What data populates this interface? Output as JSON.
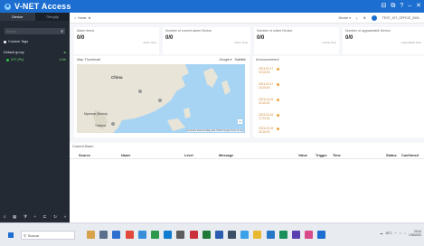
{
  "app": {
    "title": "V-NET Access",
    "window_controls": [
      "⊟",
      "⧉",
      "?",
      "–",
      "✕"
    ]
  },
  "sidebar": {
    "tabs": [
      "Device",
      "Thingify"
    ],
    "search_placeholder": "Search",
    "all_label": "Custom Tags",
    "group_label": "Default group",
    "group_count": "",
    "device_label": "IOT (Ps)",
    "device_count": "1/4h"
  },
  "topbar": {
    "breadcrumb_home": "Home",
    "breadcrumb_sep": "⊕",
    "device_menu": "Device ▾",
    "user": "TEST_IOT_OFFICE_0001"
  },
  "stats": [
    {
      "label": "Alarm Items",
      "value": "0/0",
      "link": "Alarm Now"
    },
    {
      "label": "Number of current alarm Device",
      "value": "0/0",
      "link": "Alarm Now"
    },
    {
      "label": "Number of online Device",
      "value": "0/0",
      "link": "Online Now"
    },
    {
      "label": "Number of upgradeable Device",
      "value": "0/0",
      "link": "Upgradable Now"
    }
  ],
  "map": {
    "title": "Map Thumbnail",
    "google_menu": "Google ▾",
    "satellite": "Satellite",
    "labels": [
      "China",
      "Myanmar (Burma)",
      "Thailand"
    ],
    "attribution": "Keyboard shortcuts  Map data ©2023 Google  Terms of Use"
  },
  "announcement": {
    "title": "Announcement",
    "items": [
      {
        "date": "2023-03-17",
        "time": "15:18:00"
      },
      {
        "date": "2023-03-17",
        "time": "15:18:00"
      },
      {
        "date": "2023-03-16",
        "time": "15:18:00"
      },
      {
        "date": "2023-03-16",
        "time": "17:25:00"
      },
      {
        "date": "2023-03-16",
        "time": "15:18:00"
      }
    ]
  },
  "alarm": {
    "title": "Current Alarm",
    "columns": [
      "Source",
      "Name",
      "Level",
      "Message",
      "Value",
      "Trigger",
      "Time",
      "Status",
      "Confirmed"
    ]
  },
  "taskbar": {
    "search_text": "Buscar",
    "weather": "20°C",
    "time": "23:44",
    "date": "7/18/2023"
  }
}
